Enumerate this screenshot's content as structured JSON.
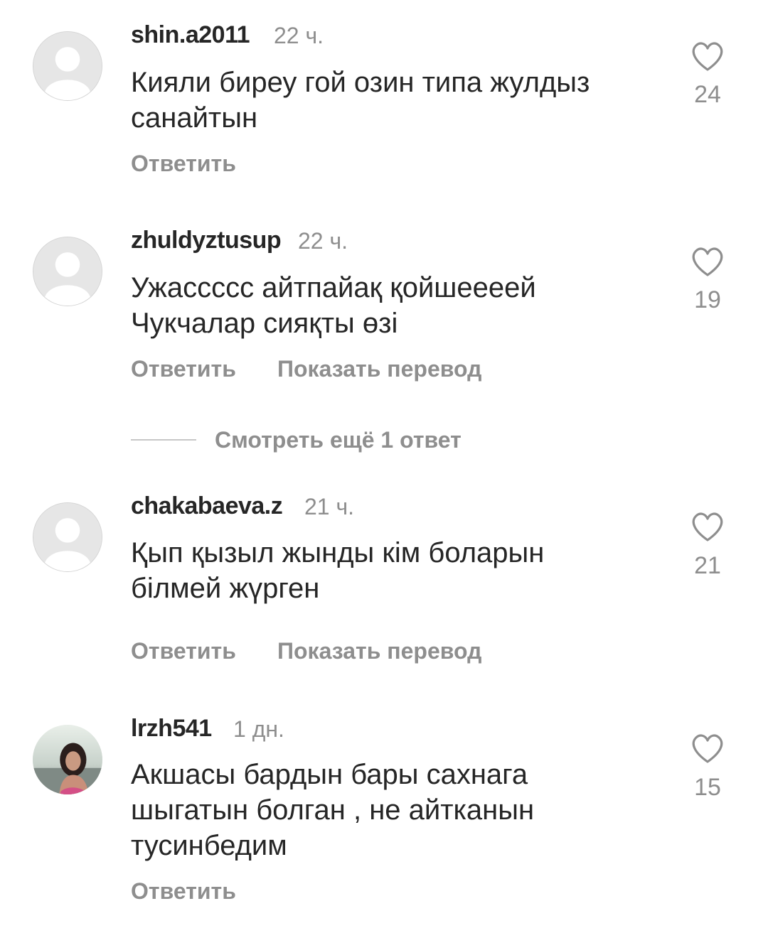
{
  "comments": [
    {
      "username": "shin.a2011",
      "time": "22 ч.",
      "text": [
        "Кияли  биреу гой озин типа жулдыз",
        "санайтын"
      ],
      "likes": "24",
      "reply_label": "Ответить",
      "avatar": "default-avatar-icon"
    },
    {
      "username": "zhuldyztusup",
      "time": "22 ч.",
      "text": [
        "Ужассссс айтпайақ қойшеееей",
        "Чукчалар сияқты өзі"
      ],
      "likes": "19",
      "reply_label": "Ответить",
      "translate_label": "Показать перевод",
      "avatar": "default-avatar-icon"
    },
    {
      "username": "chakabaeva.z",
      "time": "21 ч.",
      "text": [
        "Қып қызыл жынды кім боларын",
        "білмей жүрген"
      ],
      "likes": "21",
      "reply_label": "Ответить",
      "translate_label": "Показать перевод",
      "avatar": "default-avatar-icon"
    },
    {
      "username": "lrzh541",
      "time": "1 дн.",
      "text": [
        "Акшасы бардын бары сахнага",
        "шыгатын болган , не айтканын",
        "тусинбедим"
      ],
      "likes": "15",
      "reply_label": "Ответить",
      "avatar": "user-photo-avatar"
    }
  ],
  "view_more_replies": "Смотреть ещё 1 ответ",
  "colors": {
    "text_primary": "#262626",
    "text_secondary": "#8e8e8e",
    "background": "#ffffff"
  }
}
